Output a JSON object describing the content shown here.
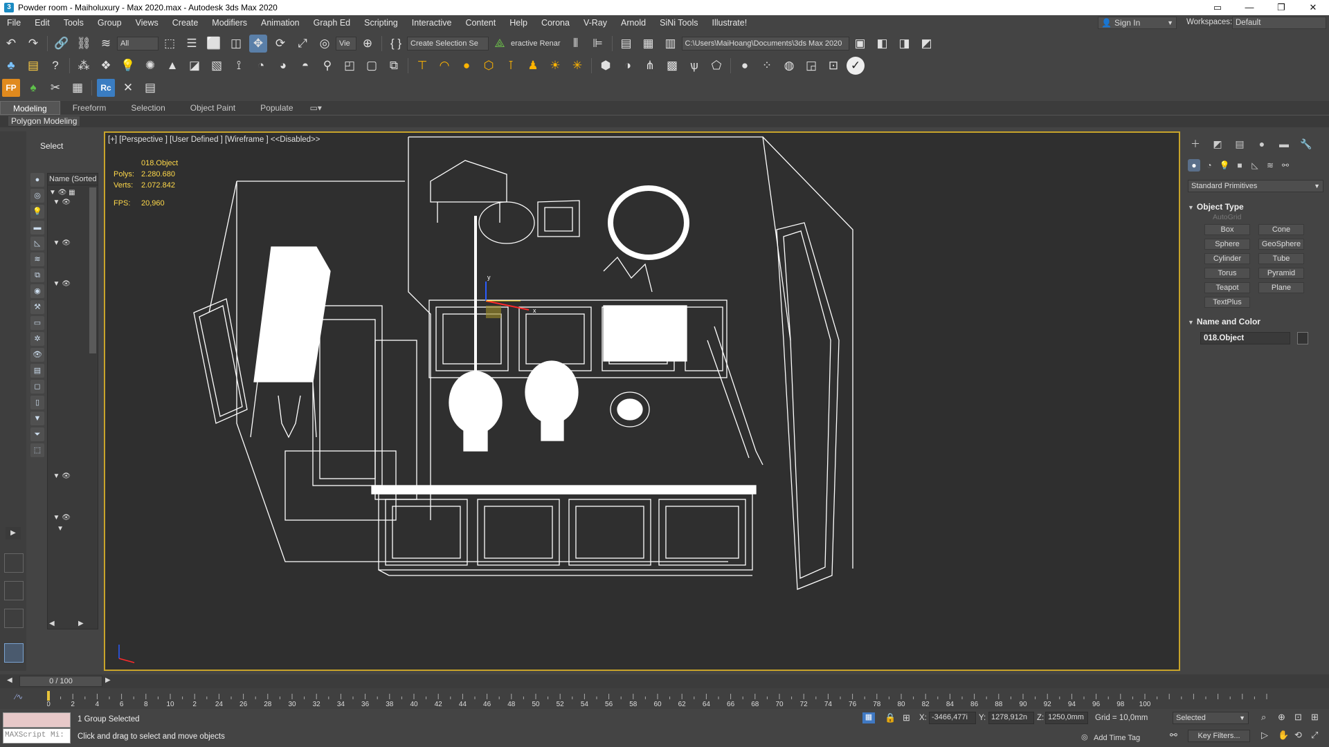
{
  "window": {
    "title": "Powder room - Maiholuxury - Max 2020.max - Autodesk 3ds Max 2020",
    "app_icon": "3"
  },
  "menu": [
    "File",
    "Edit",
    "Tools",
    "Group",
    "Views",
    "Create",
    "Modifiers",
    "Animation",
    "Graph Ed",
    "Scripting",
    "Interactive",
    "Content",
    "Help",
    "Corona",
    "V-Ray",
    "Arnold",
    "SiNi Tools",
    "Illustrate!"
  ],
  "account": {
    "sign_in": "Sign In",
    "workspaces_label": "Workspaces:",
    "workspace": "Default"
  },
  "toolbar1": {
    "filter": "All",
    "view": "Vie",
    "selection_set": "Create Selection Se",
    "render_label": "eractive Renar",
    "project_path": "C:\\Users\\MaiHoang\\Documents\\3ds Max 2020"
  },
  "ribbon": {
    "tabs": [
      "Modeling",
      "Freeform",
      "Selection",
      "Object Paint",
      "Populate"
    ],
    "active": "Modeling",
    "sub": "Polygon Modeling"
  },
  "explorer": {
    "header": "Select",
    "column": "Name (Sorted A"
  },
  "viewport": {
    "label": "[+] [Perspective ] [User Defined ] [Wireframe ]  <<Disabled>>",
    "object": "018.Object",
    "polys_label": "Polys:",
    "polys": "2.280.680",
    "verts_label": "Verts:",
    "verts": "2.072.842",
    "fps_label": "FPS:",
    "fps": "20,960"
  },
  "command_panel": {
    "category": "Standard Primitives",
    "object_type_title": "Object Type",
    "autogrid": "AutoGrid",
    "buttons": [
      "Box",
      "Cone",
      "Sphere",
      "GeoSphere",
      "Cylinder",
      "Tube",
      "Torus",
      "Pyramid",
      "Teapot",
      "Plane",
      "TextPlus"
    ],
    "name_color_title": "Name and Color",
    "object_name": "018.Object"
  },
  "timeline": {
    "frame": "0 / 100",
    "ticks": [
      "0",
      "2",
      "4",
      "6",
      "8",
      "10",
      "2",
      "24",
      "26",
      "28",
      "30",
      "32",
      "34",
      "36",
      "38",
      "40",
      "42",
      "44",
      "46",
      "48",
      "50",
      "52",
      "54",
      "56",
      "58",
      "60",
      "62",
      "64",
      "66",
      "68",
      "70",
      "72",
      "74",
      "76",
      "78",
      "80",
      "82",
      "84",
      "86",
      "88",
      "90",
      "92",
      "94",
      "96",
      "98",
      "100"
    ]
  },
  "status": {
    "selection": "1 Group Selected",
    "prompt": "Click and drag to select and move objects",
    "maxscript": "MAXScript Mi:",
    "x_label": "X:",
    "x": "-3466,477i",
    "y_label": "Y:",
    "y": "1278,912n",
    "z_label": "Z:",
    "z": "1250,0mm",
    "grid": "Grid = 10,0mm",
    "selected_dd": "Selected",
    "key_filters": "Key Filters...",
    "add_time_tag": "Add Time Tag"
  }
}
